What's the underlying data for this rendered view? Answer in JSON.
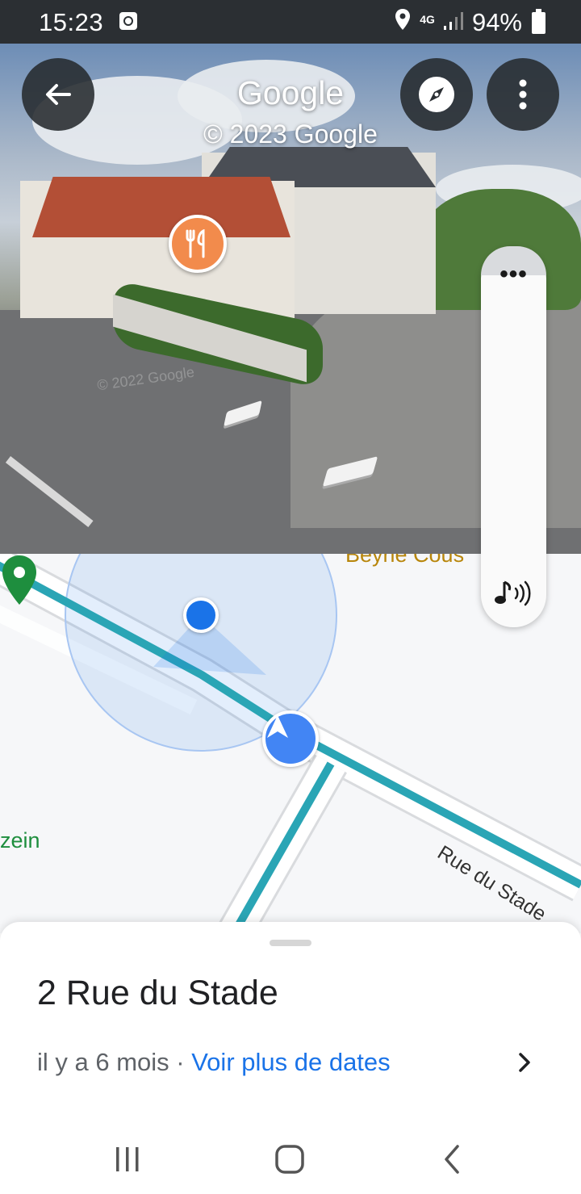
{
  "status_bar": {
    "time": "15:23",
    "network": "4G",
    "battery": "94%",
    "icons": [
      "notification-icon",
      "location-icon",
      "signal-icon",
      "battery-icon"
    ]
  },
  "street_view": {
    "title": "Google",
    "copyright": "© 2023 Google",
    "watermark": "© 2022 Google",
    "buttons": [
      "back-arrow-icon",
      "compass-icon",
      "more-vert-icon"
    ],
    "marker_icon": "restaurant-icon",
    "marker_color": "#f28b4c"
  },
  "map": {
    "street_label": "Rue du Stade",
    "place_label": "zein",
    "top_label": "Beyrie Cous",
    "route_color": "#2aa5b5",
    "location_dot_color": "#1a73e8"
  },
  "side_pill": {
    "dots": "•••",
    "sound_icon": "music-sound-icon"
  },
  "sheet": {
    "title": "2 Rue du Stade",
    "date_prefix": "il y a 6 mois · ",
    "date_link": "Voir plus de dates"
  },
  "nav_bar": {
    "buttons": [
      "recents-icon",
      "home-icon",
      "back-icon"
    ]
  }
}
